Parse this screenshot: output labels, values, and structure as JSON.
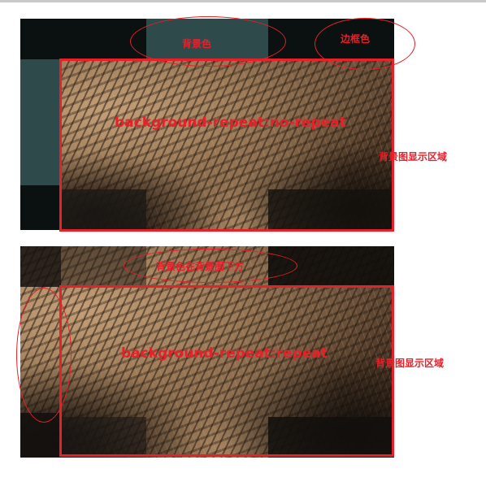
{
  "diagram1": {
    "center_label": "background-repeat:no-repeat",
    "bg_color_note": "背景色",
    "border_color_note": "边框色",
    "area_note": "背景图显示区域"
  },
  "diagram2": {
    "center_label": "background-repeat:repeat",
    "bg_below_note": "背景色在背景图下方",
    "area_note": "背景图显示区域"
  },
  "colors": {
    "annotation_red": "#e8202a",
    "background_color_teal": "#2f4a4a",
    "border_dark": "#0b1010"
  }
}
